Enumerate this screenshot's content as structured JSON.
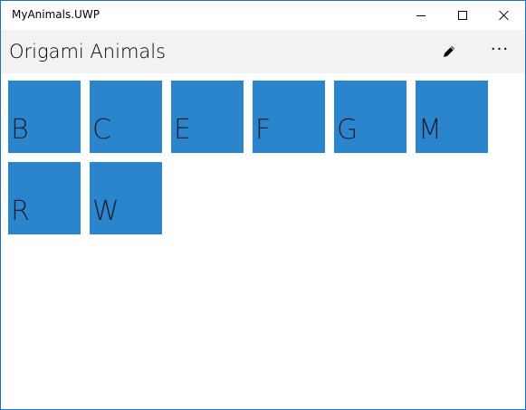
{
  "window": {
    "title": "MyAnimals.UWP"
  },
  "titlebar": {
    "buttons": [
      "minimize-icon",
      "maximize-icon",
      "close-icon"
    ]
  },
  "commandbar": {
    "title": "Origami Animals",
    "edit_icon": "pencil-icon",
    "more_icon": "more-ellipsis-icon",
    "more_glyph": "···"
  },
  "tiles": [
    {
      "letter": "B"
    },
    {
      "letter": "C"
    },
    {
      "letter": "E"
    },
    {
      "letter": "F"
    },
    {
      "letter": "G"
    },
    {
      "letter": "M"
    },
    {
      "letter": "R"
    },
    {
      "letter": "W"
    }
  ],
  "colors": {
    "tile": "#2b85cd",
    "commandbar": "#f2f2f2",
    "window_border": "#1a73c8"
  }
}
